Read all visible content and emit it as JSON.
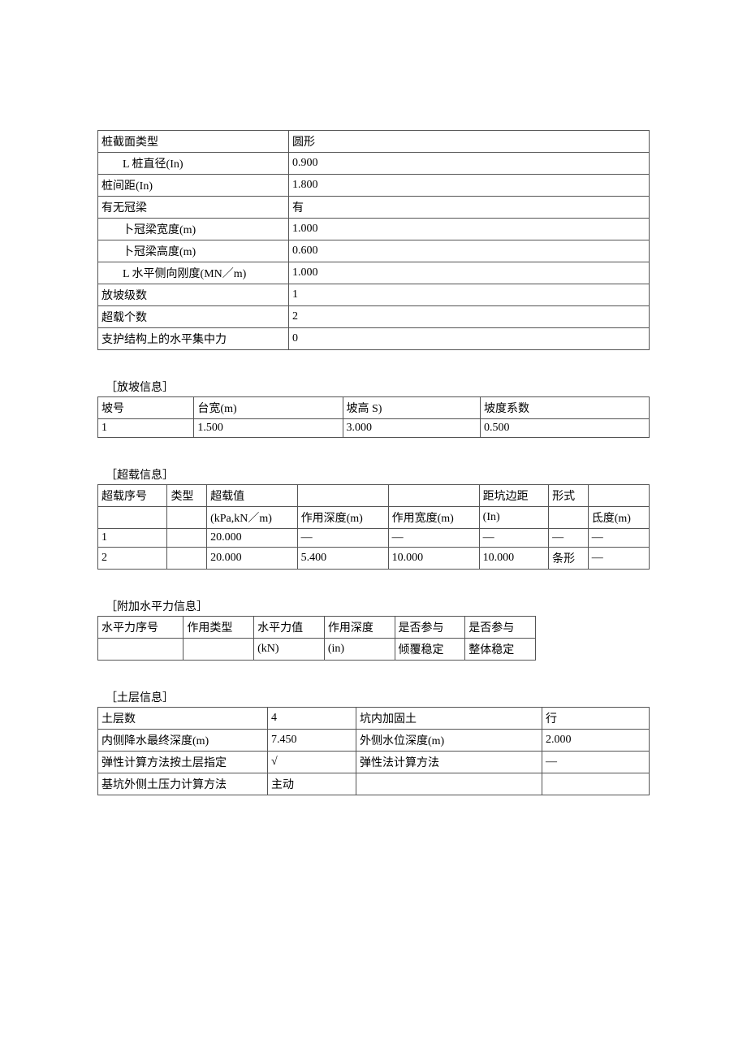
{
  "basic": {
    "rows": [
      {
        "label": "桩截面类型",
        "value": "圆形",
        "indent": false
      },
      {
        "label": "L 桩直径(In)",
        "value": "0.900",
        "indent": true
      },
      {
        "label": "桩间距(In)",
        "value": "1.800",
        "indent": false
      },
      {
        "label": "有无冠梁",
        "value": "有",
        "indent": false
      },
      {
        "label": "卜冠梁宽度(m)",
        "value": "1.000",
        "indent": true
      },
      {
        "label": "卜冠梁高度(m)",
        "value": "0.600",
        "indent": true
      },
      {
        "label": "L 水平侧向刚度(MN／m)",
        "value": "1.000",
        "indent": true
      },
      {
        "label": "放坡级数",
        "value": "1",
        "indent": false
      },
      {
        "label": "超载个数",
        "value": "2",
        "indent": false
      },
      {
        "label": "支护结构上的水平集中力",
        "value": "0",
        "indent": false
      }
    ]
  },
  "slope": {
    "title": "［放坡信息］",
    "headers": [
      "坡号",
      "台宽(m)",
      "坡高 S)",
      "坡度系数"
    ],
    "rows": [
      [
        "1",
        "1.500",
        "3.000",
        "0.500"
      ]
    ]
  },
  "overload": {
    "title": "［超载信息］",
    "headers_r1": [
      "超载序号",
      "类型",
      "超载值",
      "",
      "",
      "距坑边距",
      "形式",
      ""
    ],
    "headers_r2": [
      "",
      "",
      "(kPa,kN／m)",
      "作用深度(m)",
      "作用宽度(m)",
      "(In)",
      "",
      "氐度(m)"
    ],
    "rows": [
      [
        "1",
        "",
        "20.000",
        "—",
        "—",
        "—",
        "—",
        "—"
      ],
      [
        "2",
        "",
        "20.000",
        "5.400",
        "10.000",
        "10.000",
        "条形",
        "—"
      ]
    ]
  },
  "hforce": {
    "title": "［附加水平力信息］",
    "headers_r1": [
      "水平力序号",
      "作用类型",
      "水平力值",
      "作用深度",
      "是否参与",
      "是否参与"
    ],
    "headers_r2": [
      "",
      "",
      "(kN)",
      "(in)",
      "倾覆稳定",
      "整体稳定"
    ]
  },
  "soil": {
    "title": "［土层信息］",
    "rows": [
      [
        "土层数",
        "4",
        "坑内加固土",
        "行"
      ],
      [
        "内侧降水最终深度(m)",
        "7.450",
        "外侧水位深度(m)",
        "2.000"
      ],
      [
        "弹性计算方法按土层指定",
        "√",
        "弹性法计算方法",
        "—"
      ],
      [
        "基坑外侧土压力计算方法",
        "主动",
        "",
        ""
      ]
    ]
  }
}
